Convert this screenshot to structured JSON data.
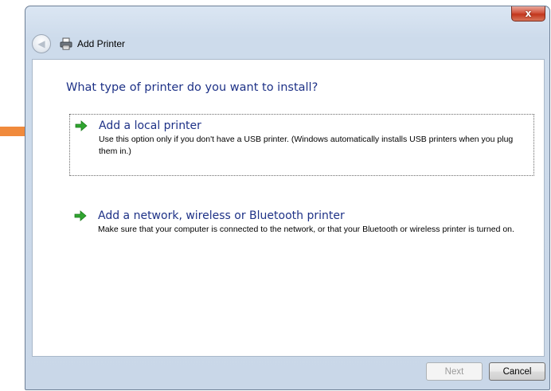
{
  "window": {
    "title": "Add Printer",
    "close_label": "x"
  },
  "main": {
    "question": "What type of printer do you want to install?",
    "options": [
      {
        "label": "Add a local printer",
        "description": "Use this option only if you don't have a USB printer. (Windows automatically installs USB printers when you plug them in.)",
        "selected": true
      },
      {
        "label": "Add a network, wireless or Bluetooth printer",
        "description": "Make sure that your computer is connected to the network, or that your Bluetooth or wireless printer is turned on.",
        "selected": false
      }
    ]
  },
  "buttons": {
    "next": "Next",
    "cancel": "Cancel"
  },
  "colors": {
    "heading_blue": "#1e3287",
    "arrow_green": "#2fa52f",
    "annotation_orange": "#f08a3c",
    "close_red": "#c94a30"
  },
  "icons": {
    "back": "back-arrow-icon",
    "printer": "printer-icon",
    "option_arrow": "green-arrow-icon"
  }
}
